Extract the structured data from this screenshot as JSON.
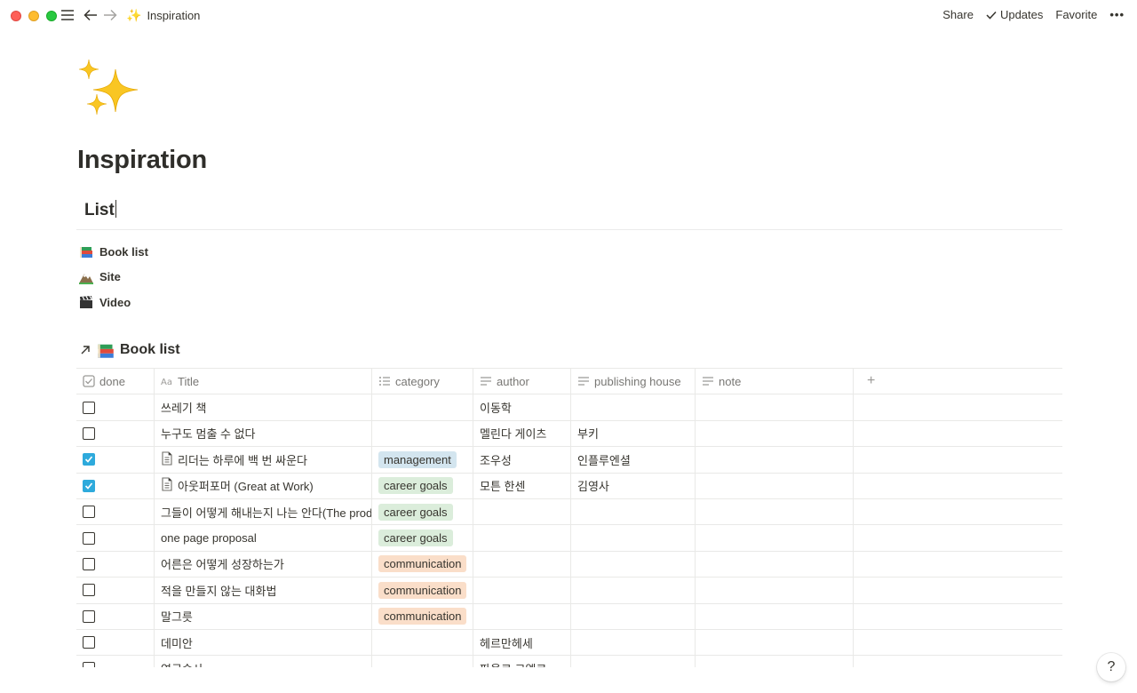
{
  "window": {
    "breadcrumb": {
      "emoji": "✨",
      "label": "Inspiration"
    },
    "actions": {
      "share": "Share",
      "updates": "Updates",
      "favorite": "Favorite",
      "more": "•••"
    }
  },
  "page": {
    "icon": "sparkles-icon",
    "title": "Inspiration",
    "heading": "List",
    "links": [
      {
        "icon": "books-icon",
        "label": "Book list"
      },
      {
        "icon": "mountain-icon",
        "label": "Site"
      },
      {
        "icon": "clapper-icon",
        "label": "Video"
      }
    ]
  },
  "database": {
    "title": "Book list",
    "columns": [
      "done",
      "Title",
      "category",
      "author",
      "publishing house",
      "note"
    ],
    "add_column": "+",
    "rows": [
      {
        "done": false,
        "title": "쓰레기 책",
        "doc": false,
        "category": "",
        "author": "이동학",
        "publisher": "",
        "note": ""
      },
      {
        "done": false,
        "title": "누구도 멈출 수 없다",
        "doc": false,
        "category": "",
        "author": "멜린다 게이츠",
        "publisher": "부키",
        "note": ""
      },
      {
        "done": true,
        "title": "리더는 하루에 백 번 싸운다",
        "doc": true,
        "category": "management",
        "author": "조우성",
        "publisher": "인플루엔셜",
        "note": ""
      },
      {
        "done": true,
        "title": "아웃퍼포머 (Great at Work)",
        "doc": true,
        "category": "career goals",
        "author": "모튼 한센",
        "publisher": "김영사",
        "note": ""
      },
      {
        "done": false,
        "title": "그들이 어떻게 해내는지 나는 안다(The produc",
        "doc": false,
        "category": "career goals",
        "author": "",
        "publisher": "",
        "note": ""
      },
      {
        "done": false,
        "title": "one page proposal",
        "doc": false,
        "category": "career goals",
        "author": "",
        "publisher": "",
        "note": ""
      },
      {
        "done": false,
        "title": "어른은 어떻게 성장하는가",
        "doc": false,
        "category": "communication",
        "author": "",
        "publisher": "",
        "note": ""
      },
      {
        "done": false,
        "title": "적을 만들지 않는 대화법",
        "doc": false,
        "category": "communication",
        "author": "",
        "publisher": "",
        "note": ""
      },
      {
        "done": false,
        "title": "말그릇",
        "doc": false,
        "category": "communication",
        "author": "",
        "publisher": "",
        "note": ""
      },
      {
        "done": false,
        "title": "데미안",
        "doc": false,
        "category": "",
        "author": "헤르만헤세",
        "publisher": "",
        "note": ""
      },
      {
        "done": false,
        "title": "연금술사",
        "doc": false,
        "category": "",
        "author": "파울로 코엘료",
        "publisher": "",
        "note": ""
      }
    ],
    "category_colors": {
      "management": "#d3e5ef",
      "career goals": "#dbeddb",
      "communication": "#fadec9"
    }
  },
  "help": "?"
}
